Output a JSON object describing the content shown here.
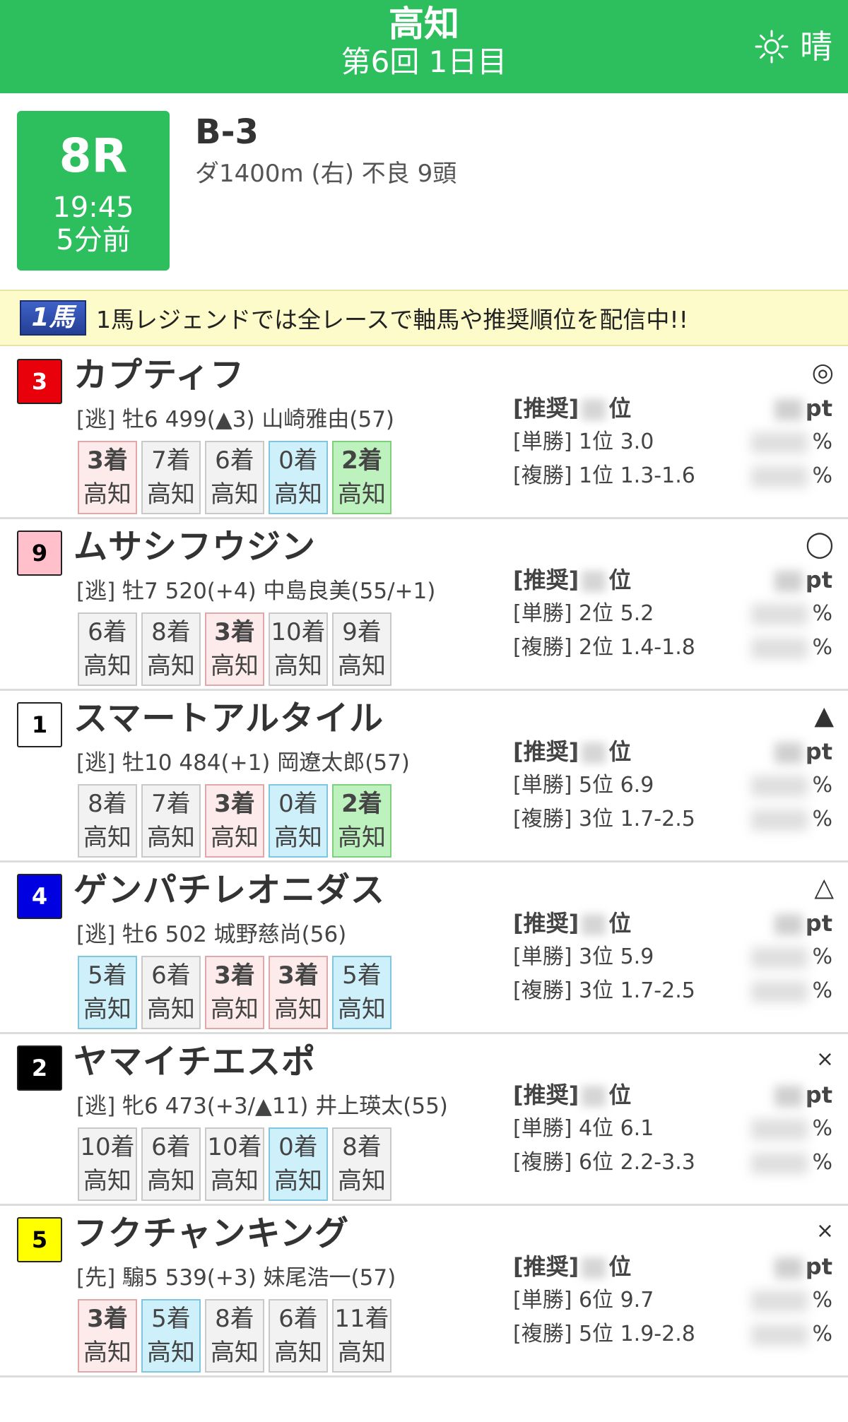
{
  "header": {
    "venue": "高知",
    "meet": "第6回 1日目",
    "weather_icon": "sun-icon",
    "weather": "晴"
  },
  "race": {
    "number": "8R",
    "time": "19:45",
    "until": "5分前",
    "class": "B-3",
    "conditions": "ダ1400m (右) 不良 9頭"
  },
  "banner": {
    "logo": "1馬",
    "text": "1馬レジェンドでは全レースで軸馬や推奨順位を配信中!!"
  },
  "labels": {
    "rec": "[推奨]",
    "rank_suffix": "位",
    "pt": "pt",
    "pct": "%"
  },
  "horses": [
    {
      "gate": "3",
      "gate_bg": "#e8000b",
      "gate_fg": "#ffffff",
      "name": "カプティフ",
      "info": "[逃] 牡6 499(▲3) 山崎雅由(57)",
      "mark": "◎",
      "results": [
        {
          "pos": "3着",
          "venue": "高知",
          "style": "top3"
        },
        {
          "pos": "7着",
          "venue": "高知",
          "style": ""
        },
        {
          "pos": "6着",
          "venue": "高知",
          "style": ""
        },
        {
          "pos": "0着",
          "venue": "高知",
          "style": "blue"
        },
        {
          "pos": "2着",
          "venue": "高知",
          "style": "second"
        }
      ],
      "win": "[単勝] 1位 3.0",
      "place": "[複勝] 1位 1.3-1.6"
    },
    {
      "gate": "9",
      "gate_bg": "#ffc0cb",
      "gate_fg": "#000000",
      "name": "ムサシフウジン",
      "info": "[逃] 牡7 520(+4) 中島良美(55/+1)",
      "mark": "◯",
      "results": [
        {
          "pos": "6着",
          "venue": "高知",
          "style": ""
        },
        {
          "pos": "8着",
          "venue": "高知",
          "style": ""
        },
        {
          "pos": "3着",
          "venue": "高知",
          "style": "top3"
        },
        {
          "pos": "10着",
          "venue": "高知",
          "style": ""
        },
        {
          "pos": "9着",
          "venue": "高知",
          "style": ""
        }
      ],
      "win": "[単勝] 2位 5.2",
      "place": "[複勝] 2位 1.4-1.8"
    },
    {
      "gate": "1",
      "gate_bg": "#ffffff",
      "gate_fg": "#000000",
      "name": "スマートアルタイル",
      "info": "[逃] 牡10 484(+1) 岡遼太郎(57)",
      "mark": "▲",
      "results": [
        {
          "pos": "8着",
          "venue": "高知",
          "style": ""
        },
        {
          "pos": "7着",
          "venue": "高知",
          "style": ""
        },
        {
          "pos": "3着",
          "venue": "高知",
          "style": "top3"
        },
        {
          "pos": "0着",
          "venue": "高知",
          "style": "blue"
        },
        {
          "pos": "2着",
          "venue": "高知",
          "style": "second"
        }
      ],
      "win": "[単勝] 5位 6.9",
      "place": "[複勝] 3位 1.7-2.5"
    },
    {
      "gate": "4",
      "gate_bg": "#0000e0",
      "gate_fg": "#ffffff",
      "name": "ゲンパチレオニダス",
      "info": "[逃] 牡6 502 城野慈尚(56)",
      "mark": "△",
      "results": [
        {
          "pos": "5着",
          "venue": "高知",
          "style": "blue"
        },
        {
          "pos": "6着",
          "venue": "高知",
          "style": ""
        },
        {
          "pos": "3着",
          "venue": "高知",
          "style": "top3"
        },
        {
          "pos": "3着",
          "venue": "高知",
          "style": "top3"
        },
        {
          "pos": "5着",
          "venue": "高知",
          "style": "blue"
        }
      ],
      "win": "[単勝] 3位 5.9",
      "place": "[複勝] 3位 1.7-2.5"
    },
    {
      "gate": "2",
      "gate_bg": "#000000",
      "gate_fg": "#ffffff",
      "name": "ヤマイチエスポ",
      "info": "[逃] 牝6 473(+3/▲11) 井上瑛太(55)",
      "mark": "×",
      "results": [
        {
          "pos": "10着",
          "venue": "高知",
          "style": ""
        },
        {
          "pos": "6着",
          "venue": "高知",
          "style": ""
        },
        {
          "pos": "10着",
          "venue": "高知",
          "style": ""
        },
        {
          "pos": "0着",
          "venue": "高知",
          "style": "blue"
        },
        {
          "pos": "8着",
          "venue": "高知",
          "style": ""
        }
      ],
      "win": "[単勝] 4位 6.1",
      "place": "[複勝] 6位 2.2-3.3"
    },
    {
      "gate": "5",
      "gate_bg": "#ffff00",
      "gate_fg": "#000000",
      "name": "フクチャンキング",
      "info": "[先] 騸5 539(+3) 妹尾浩一(57)",
      "mark": "×",
      "results": [
        {
          "pos": "3着",
          "venue": "高知",
          "style": "top3"
        },
        {
          "pos": "5着",
          "venue": "高知",
          "style": "blue"
        },
        {
          "pos": "8着",
          "venue": "高知",
          "style": ""
        },
        {
          "pos": "6着",
          "venue": "高知",
          "style": ""
        },
        {
          "pos": "11着",
          "venue": "高知",
          "style": ""
        }
      ],
      "win": "[単勝] 6位 9.7",
      "place": "[複勝] 5位 1.9-2.8"
    }
  ]
}
